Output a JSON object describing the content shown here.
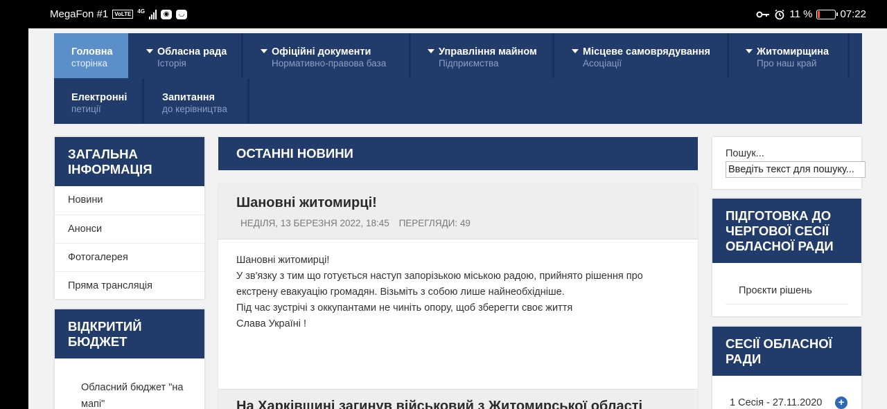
{
  "status_bar": {
    "carrier": "MegaFon #1",
    "volte": "VoLTE",
    "network": "4G",
    "battery_percent": "11 %",
    "battery_level": 0.11,
    "time": "07:22"
  },
  "nav": {
    "items": [
      {
        "title": "Головна",
        "subtitle": "сторінка"
      },
      {
        "title": "Обласна рада",
        "subtitle": "Історія"
      },
      {
        "title": "Офіційні документи",
        "subtitle": "Нормативно-правова база"
      },
      {
        "title": "Управління майном",
        "subtitle": "Підприємства"
      },
      {
        "title": "Місцеве самоврядування",
        "subtitle": "Асоціації"
      },
      {
        "title": "Житомирщина",
        "subtitle": "Про наш край"
      },
      {
        "title": "Електронні",
        "subtitle": "петиції"
      },
      {
        "title": "Запитання",
        "subtitle": "до керівництва"
      }
    ]
  },
  "left": {
    "general": {
      "title": "Загальна інформація",
      "items": [
        "Новини",
        "Анонси",
        "Фотогалерея",
        "Пряма трансляція"
      ]
    },
    "budget": {
      "title": "Відкритий бюджет",
      "item": "Обласний бюджет \"на мапі\""
    }
  },
  "main": {
    "section_title": "ОСТАННІ НОВИНИ",
    "article": {
      "title": "Шановні житомирці!",
      "date": "НЕДІЛЯ, 13 БЕРЕЗНЯ 2022, 18:45",
      "views": "ПЕРЕГЛЯДИ: 49",
      "lines": [
        "Шановні житомирці!",
        "У зв'язку з тим що готується наступ запорізькою міською радою, прийнято рішення про",
        "екстрену евакуацію громадян. Візьміть з собою лише найнеобхідніше.",
        "Під час зустрічі з оккупантами не чиніть опору, щоб зберегти своє життя",
        "Слава Україні !"
      ]
    },
    "article2_title": "На Харківщині загинув військовий з Житомирської області"
  },
  "right": {
    "search_label": "Пошук...",
    "search_placeholder": "Введіть текст для пошуку...",
    "session_prep": {
      "title": "Підготовка до чергової сесії обласної ради",
      "item": "Проєкти рішень"
    },
    "sessions": {
      "title": "Сесії обласної ради",
      "item": "1 Сесія - 27.11.2020"
    }
  }
}
